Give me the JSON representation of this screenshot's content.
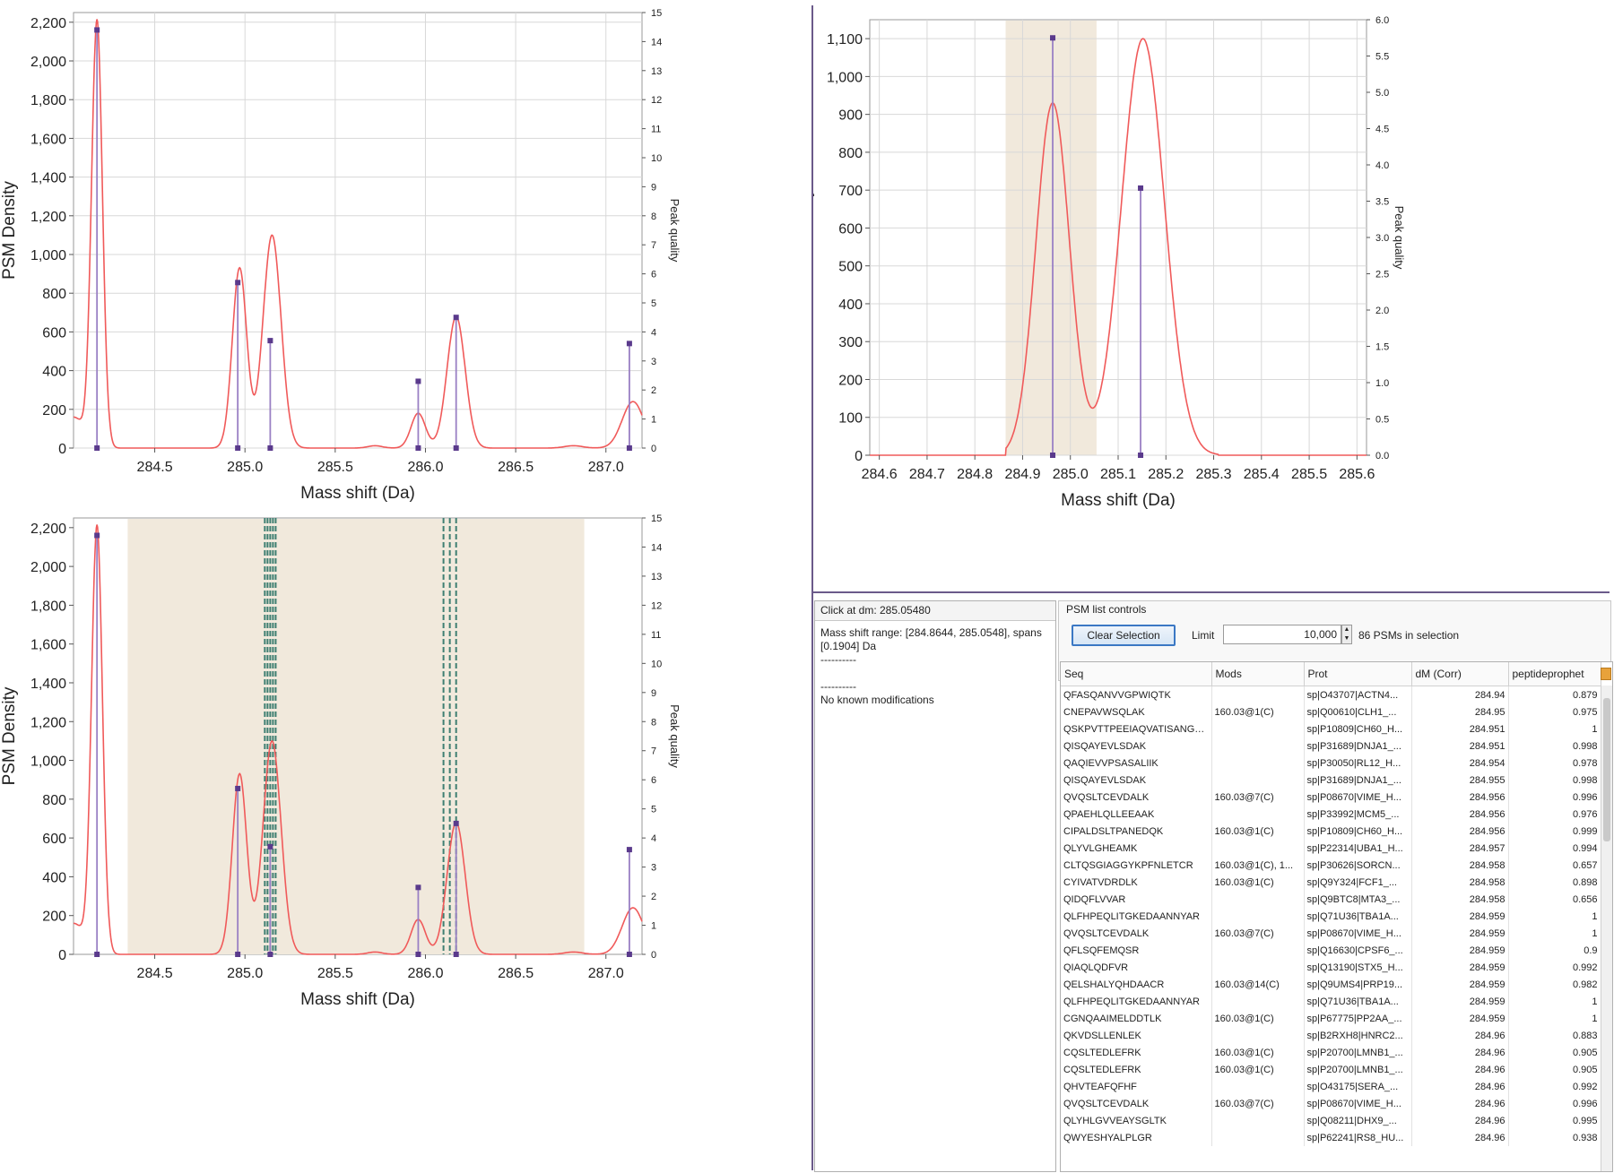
{
  "chart_data": [
    {
      "type": "line",
      "id": "top-left",
      "xlabel": "Mass shift (Da)",
      "ylabel": "PSM Density",
      "y2label": "Peak quality",
      "xlim": [
        284.05,
        287.2
      ],
      "ylim": [
        0,
        2250
      ],
      "y2lim": [
        0,
        15
      ],
      "xticks": [
        284.5,
        285.0,
        285.5,
        286.0,
        286.5,
        287.0
      ],
      "xtick_labels": [
        "284.5",
        "285.0",
        "285.5",
        "286.0",
        "286.5",
        "287.0"
      ],
      "yticks": [
        0,
        200,
        400,
        600,
        800,
        1000,
        1200,
        1400,
        1600,
        1800,
        2000,
        2200
      ],
      "ytick_labels": [
        "0",
        "200",
        "400",
        "600",
        "800",
        "1,000",
        "1,200",
        "1,400",
        "1,600",
        "1,800",
        "2,000",
        "2,200"
      ],
      "y2ticks": [
        0,
        1,
        2,
        3,
        4,
        5,
        6,
        7,
        8,
        9,
        10,
        11,
        12,
        13,
        14,
        15
      ],
      "y2tick_labels": [
        "0",
        "1",
        "2",
        "3",
        "4",
        "5",
        "6",
        "7",
        "8",
        "9",
        "10",
        "11",
        "12",
        "13",
        "14",
        "15"
      ],
      "density_peaks": [
        {
          "center": 284.18,
          "height": 2200,
          "width": 0.03
        },
        {
          "center": 284.97,
          "height": 930,
          "width": 0.04
        },
        {
          "center": 285.15,
          "height": 1100,
          "width": 0.05
        },
        {
          "center": 285.72,
          "height": 12,
          "width": 0.04
        },
        {
          "center": 285.96,
          "height": 180,
          "width": 0.04
        },
        {
          "center": 286.17,
          "height": 680,
          "width": 0.05
        },
        {
          "center": 286.82,
          "height": 12,
          "width": 0.05
        },
        {
          "center": 287.15,
          "height": 240,
          "width": 0.06
        }
      ],
      "density_baseline_left": 160,
      "peak_quality": [
        {
          "x": 284.18,
          "q": 14.4
        },
        {
          "x": 284.96,
          "q": 5.7
        },
        {
          "x": 285.14,
          "q": 3.7
        },
        {
          "x": 285.96,
          "q": 2.3
        },
        {
          "x": 286.17,
          "q": 4.5
        },
        {
          "x": 287.13,
          "q": 3.6
        }
      ],
      "grid": true
    },
    {
      "type": "line",
      "id": "top-right",
      "xlabel": "Mass shift (Da)",
      "ylabel": "PSM Density",
      "y2label": "Peak quality",
      "xlim": [
        284.58,
        285.62
      ],
      "ylim": [
        0,
        1150
      ],
      "y2lim": [
        0,
        6
      ],
      "xticks": [
        284.6,
        284.7,
        284.8,
        284.9,
        285.0,
        285.1,
        285.2,
        285.3,
        285.4,
        285.5,
        285.6
      ],
      "xtick_labels": [
        "284.6",
        "284.7",
        "284.8",
        "284.9",
        "285.0",
        "285.1",
        "285.2",
        "285.3",
        "285.4",
        "285.5",
        "285.6"
      ],
      "yticks": [
        0,
        100,
        200,
        300,
        400,
        500,
        600,
        700,
        800,
        900,
        1000,
        1100
      ],
      "ytick_labels": [
        "0",
        "100",
        "200",
        "300",
        "400",
        "500",
        "600",
        "700",
        "800",
        "900",
        "1,000",
        "1,100"
      ],
      "y2ticks": [
        0,
        0.5,
        1.0,
        1.5,
        2.0,
        2.5,
        3.0,
        3.5,
        4.0,
        4.5,
        5.0,
        5.5,
        6.0
      ],
      "y2tick_labels": [
        "0.0",
        "0.5",
        "1.0",
        "1.5",
        "2.0",
        "2.5",
        "3.0",
        "3.5",
        "4.0",
        "4.5",
        "5.0",
        "5.5",
        "6.0"
      ],
      "selection": [
        284.8644,
        285.0548
      ],
      "density_peaks": [
        {
          "center": 284.963,
          "height": 930,
          "width": 0.035
        },
        {
          "center": 285.152,
          "height": 1100,
          "width": 0.045
        }
      ],
      "density_support": [
        284.865,
        285.31
      ],
      "peak_quality": [
        {
          "x": 284.963,
          "q": 5.75
        },
        {
          "x": 285.147,
          "q": 3.68
        }
      ],
      "grid": true
    },
    {
      "type": "line",
      "id": "bottom-left",
      "xlabel": "Mass shift (Da)",
      "ylabel": "PSM Density",
      "y2label": "Peak quality",
      "xlim": [
        284.05,
        287.2
      ],
      "ylim": [
        0,
        2250
      ],
      "y2lim": [
        0,
        15
      ],
      "xticks": [
        284.5,
        285.0,
        285.5,
        286.0,
        286.5,
        287.0
      ],
      "xtick_labels": [
        "284.5",
        "285.0",
        "285.5",
        "286.0",
        "286.5",
        "287.0"
      ],
      "yticks": [
        0,
        200,
        400,
        600,
        800,
        1000,
        1200,
        1400,
        1600,
        1800,
        2000,
        2200
      ],
      "ytick_labels": [
        "0",
        "200",
        "400",
        "600",
        "800",
        "1,000",
        "1,200",
        "1,400",
        "1,600",
        "1,800",
        "2,000",
        "2,200"
      ],
      "y2ticks": [
        0,
        1,
        2,
        3,
        4,
        5,
        6,
        7,
        8,
        9,
        10,
        11,
        12,
        13,
        14,
        15
      ],
      "y2tick_labels": [
        "0",
        "1",
        "2",
        "3",
        "4",
        "5",
        "6",
        "7",
        "8",
        "9",
        "10",
        "11",
        "12",
        "13",
        "14",
        "15"
      ],
      "selection": [
        284.35,
        286.88
      ],
      "dashed_markers": [
        285.11,
        285.125,
        285.14,
        285.155,
        285.17,
        286.1,
        286.135,
        286.17
      ],
      "density_peaks": [
        {
          "center": 284.18,
          "height": 2200,
          "width": 0.03
        },
        {
          "center": 284.97,
          "height": 930,
          "width": 0.04
        },
        {
          "center": 285.15,
          "height": 1100,
          "width": 0.05
        },
        {
          "center": 285.72,
          "height": 12,
          "width": 0.04
        },
        {
          "center": 285.96,
          "height": 180,
          "width": 0.04
        },
        {
          "center": 286.17,
          "height": 680,
          "width": 0.05
        },
        {
          "center": 286.82,
          "height": 12,
          "width": 0.05
        },
        {
          "center": 287.15,
          "height": 240,
          "width": 0.06
        }
      ],
      "density_baseline_left": 160,
      "peak_quality": [
        {
          "x": 284.18,
          "q": 14.4
        },
        {
          "x": 284.96,
          "q": 5.7
        },
        {
          "x": 285.14,
          "q": 3.7
        },
        {
          "x": 285.96,
          "q": 2.3
        },
        {
          "x": 286.17,
          "q": 4.5
        },
        {
          "x": 287.13,
          "q": 3.6
        }
      ],
      "grid": false
    }
  ],
  "colors": {
    "density": "#f05a5a",
    "quality_stem": "#9a80c4",
    "quality_marker": "#5a3a8c",
    "selection": "#f1e9dc",
    "dashed": "#3f7f72",
    "grid": "#d8d8d8"
  },
  "info": {
    "header": "Click at dm: 285.05480",
    "range": "Mass shift range: [284.8644, 285.0548], spans [0.1904] Da",
    "sep1": "----------",
    "sep2": "----------",
    "mods": "No known modifications"
  },
  "controls": {
    "legend": "PSM list controls",
    "clear_button": "Clear Selection",
    "limit_label": "Limit",
    "limit_value": "10,000",
    "selection_count": "86 PSMs in selection"
  },
  "table": {
    "columns": [
      "Seq",
      "Mods",
      "Prot",
      "dM (Corr)",
      "peptideprophet"
    ],
    "rows": [
      [
        "QFASQANVVGPWIQTK",
        "",
        "sp|O43707|ACTN4...",
        "284.94",
        "0.879"
      ],
      [
        "CNEPAVWSQLAK",
        "160.03@1(C)",
        "sp|Q00610|CLH1_...",
        "284.95",
        "0.975"
      ],
      [
        "QSKPVTTPEEIAQVATISANGDK",
        "",
        "sp|P10809|CH60_H...",
        "284.951",
        "1"
      ],
      [
        "QISQAYEVLSDAK",
        "",
        "sp|P31689|DNJA1_...",
        "284.951",
        "0.998"
      ],
      [
        "QAQIEVVPSASALIIK",
        "",
        "sp|P30050|RL12_H...",
        "284.954",
        "0.978"
      ],
      [
        "QISQAYEVLSDAK",
        "",
        "sp|P31689|DNJA1_...",
        "284.955",
        "0.998"
      ],
      [
        "QVQSLTCEVDALK",
        "160.03@7(C)",
        "sp|P08670|VIME_H...",
        "284.956",
        "0.996"
      ],
      [
        "QPAEHLQLLEEAAK",
        "",
        "sp|P33992|MCM5_...",
        "284.956",
        "0.976"
      ],
      [
        "CIPALDSLTPANEDQK",
        "160.03@1(C)",
        "sp|P10809|CH60_H...",
        "284.956",
        "0.999"
      ],
      [
        "QLYVLGHEAMK",
        "",
        "sp|P22314|UBA1_H...",
        "284.957",
        "0.994"
      ],
      [
        "CLTQSGIAGGYKPFNLETCR",
        "160.03@1(C), 1...",
        "sp|P30626|SORCN...",
        "284.958",
        "0.657"
      ],
      [
        "CYIVATVDRDLK",
        "160.03@1(C)",
        "sp|Q9Y324|FCF1_...",
        "284.958",
        "0.898"
      ],
      [
        "QIDQFLVVAR",
        "",
        "sp|Q9BTC8|MTA3_...",
        "284.958",
        "0.656"
      ],
      [
        "QLFHPEQLITGKEDAANNYAR",
        "",
        "sp|Q71U36|TBA1A...",
        "284.959",
        "1"
      ],
      [
        "QVQSLTCEVDALK",
        "160.03@7(C)",
        "sp|P08670|VIME_H...",
        "284.959",
        "1"
      ],
      [
        "QFLSQFEMQSR",
        "",
        "sp|Q16630|CPSF6_...",
        "284.959",
        "0.9"
      ],
      [
        "QIAQLQDFVR",
        "",
        "sp|Q13190|STX5_H...",
        "284.959",
        "0.992"
      ],
      [
        "QELSHALYQHDAACR",
        "160.03@14(C)",
        "sp|Q9UMS4|PRP19...",
        "284.959",
        "0.982"
      ],
      [
        "QLFHPEQLITGKEDAANNYAR",
        "",
        "sp|Q71U36|TBA1A...",
        "284.959",
        "1"
      ],
      [
        "CGNQAAIMELDDTLK",
        "160.03@1(C)",
        "sp|P67775|PP2AA_...",
        "284.959",
        "1"
      ],
      [
        "QKVDSLLENLEK",
        "",
        "sp|B2RXH8|HNRC2...",
        "284.96",
        "0.883"
      ],
      [
        "CQSLTEDLEFRK",
        "160.03@1(C)",
        "sp|P20700|LMNB1_...",
        "284.96",
        "0.905"
      ],
      [
        "CQSLTEDLEFRK",
        "160.03@1(C)",
        "sp|P20700|LMNB1_...",
        "284.96",
        "0.905"
      ],
      [
        "QHVTEAFQFHF",
        "",
        "sp|O43175|SERA_...",
        "284.96",
        "0.992"
      ],
      [
        "QVQSLTCEVDALK",
        "160.03@7(C)",
        "sp|P08670|VIME_H...",
        "284.96",
        "0.996"
      ],
      [
        "QLYHLGVVEAYSGLTK",
        "",
        "sp|Q08211|DHX9_...",
        "284.96",
        "0.995"
      ],
      [
        "QWYESHYALPLGR",
        "",
        "sp|P62241|RS8_HU...",
        "284.96",
        "0.938"
      ]
    ]
  }
}
